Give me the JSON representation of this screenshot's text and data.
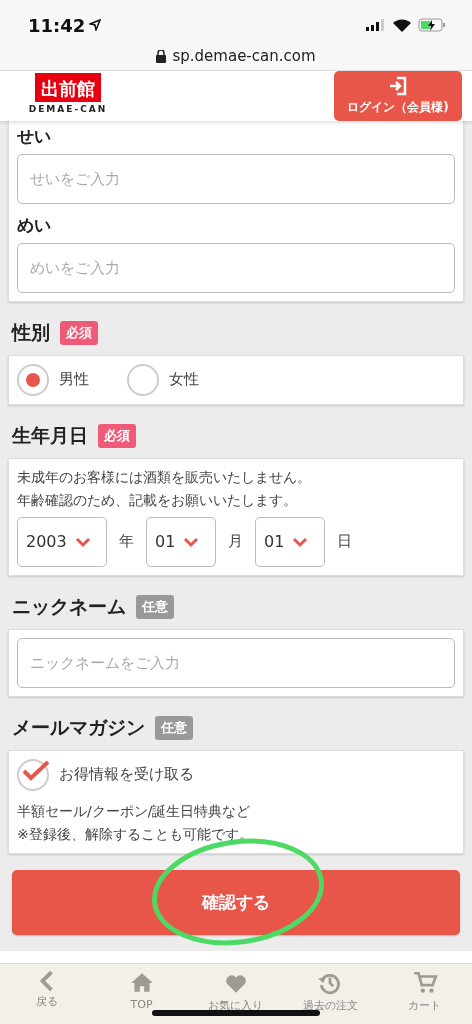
{
  "status_bar": {
    "time": "11:42"
  },
  "address_bar": {
    "url": "sp.demae-can.com"
  },
  "header": {
    "logo_mark": "出前館",
    "logo_text": "DEMAE-CAN",
    "login_button": "ログイン（会員様)"
  },
  "name_fields": [
    {
      "label": "せい",
      "placeholder": "せいをご入力"
    },
    {
      "label": "めい",
      "placeholder": "めいをご入力"
    }
  ],
  "gender": {
    "label": "性別",
    "badge": {
      "text": "必須",
      "required": true
    },
    "options": [
      {
        "label": "男性",
        "selected": true
      },
      {
        "label": "女性",
        "selected": false
      }
    ]
  },
  "birthday": {
    "label": "生年月日",
    "badge": {
      "text": "必須",
      "required": true
    },
    "notes": [
      "未成年のお客様には酒類を販売いたしません。",
      "年齢確認のため、記載をお願いいたします。"
    ],
    "selects": [
      {
        "value": "2003",
        "unit": "年"
      },
      {
        "value": "01",
        "unit": "月"
      },
      {
        "value": "01",
        "unit": "日"
      }
    ]
  },
  "nickname": {
    "label": "ニックネーム",
    "badge": {
      "text": "任意",
      "required": false
    },
    "placeholder": "ニックネームをご入力"
  },
  "newsletter": {
    "label": "メールマガジン",
    "badge": {
      "text": "任意",
      "required": false
    },
    "checkbox": {
      "label": "お得情報を受け取る",
      "checked": true
    },
    "notes": [
      "半額セール/クーポン/誕生日特典など",
      "※登録後、解除することも可能です。"
    ]
  },
  "confirm_button": "確認する",
  "annotation": {
    "kind": "circle"
  },
  "tab_bar": [
    {
      "kind": "back",
      "label": "戻る"
    },
    {
      "kind": "home",
      "label": "TOP"
    },
    {
      "kind": "favorite",
      "label": "お気に入り"
    },
    {
      "kind": "history",
      "label": "過去の注文"
    },
    {
      "kind": "cart",
      "label": "カート"
    }
  ]
}
